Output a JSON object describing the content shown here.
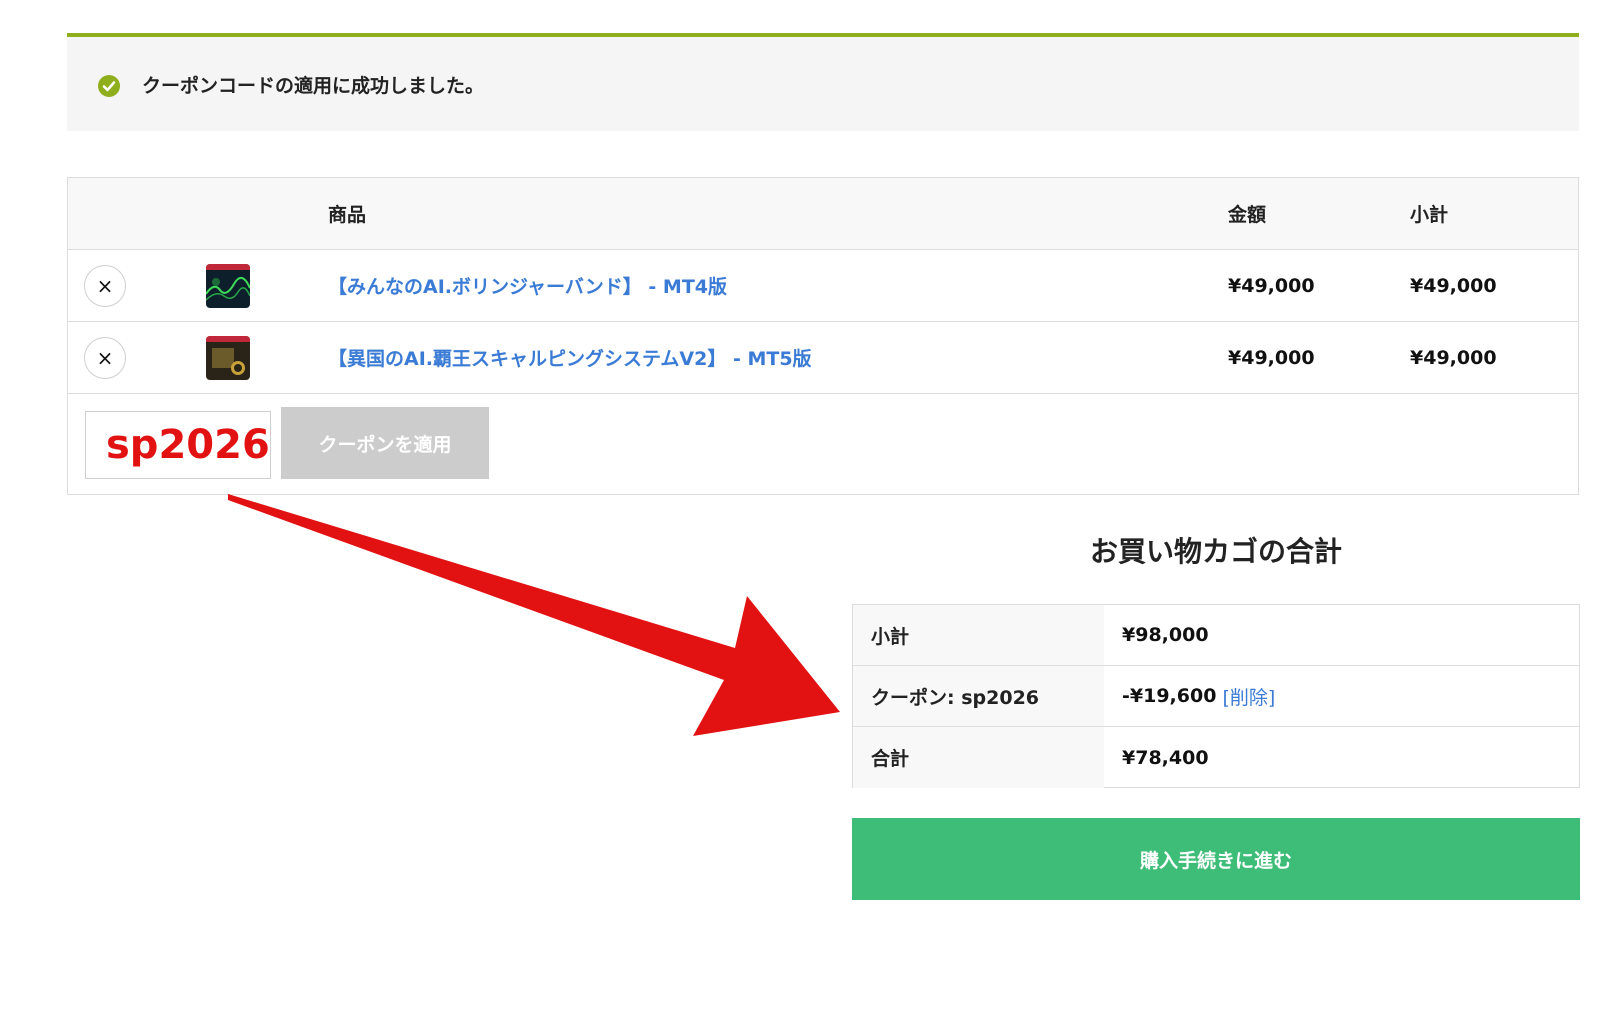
{
  "notice": {
    "icon": "check-circle-icon",
    "text": "クーポンコードの適用に成功しました。"
  },
  "cart": {
    "headers": {
      "product": "商品",
      "price": "金額",
      "subtotal": "小計"
    },
    "items": [
      {
        "name": "【みんなのAI.ボリンジャーバンド】 - MT4版",
        "price": "¥49,000",
        "subtotal": "¥49,000",
        "remove": "×"
      },
      {
        "name": "【異国のAI.覇王スキャルピングシステムV2】 - MT5版",
        "price": "¥49,000",
        "subtotal": "¥49,000",
        "remove": "×"
      }
    ],
    "coupon": {
      "value": "sp2026",
      "button": "クーポンを適用"
    }
  },
  "totals": {
    "title": "お買い物カゴの合計",
    "subtotal_label": "小計",
    "subtotal_value": "¥98,000",
    "coupon_label": "クーポン: sp2026",
    "coupon_value": "-¥19,600",
    "coupon_remove": "[削除]",
    "total_label": "合計",
    "total_value": "¥78,400"
  },
  "checkout": {
    "label": "購入手続きに進む"
  },
  "colors": {
    "accent_green": "#3dbd77",
    "notice_border": "#8fae1b",
    "link": "#3a7bd5",
    "annotation_red": "#e31212"
  }
}
